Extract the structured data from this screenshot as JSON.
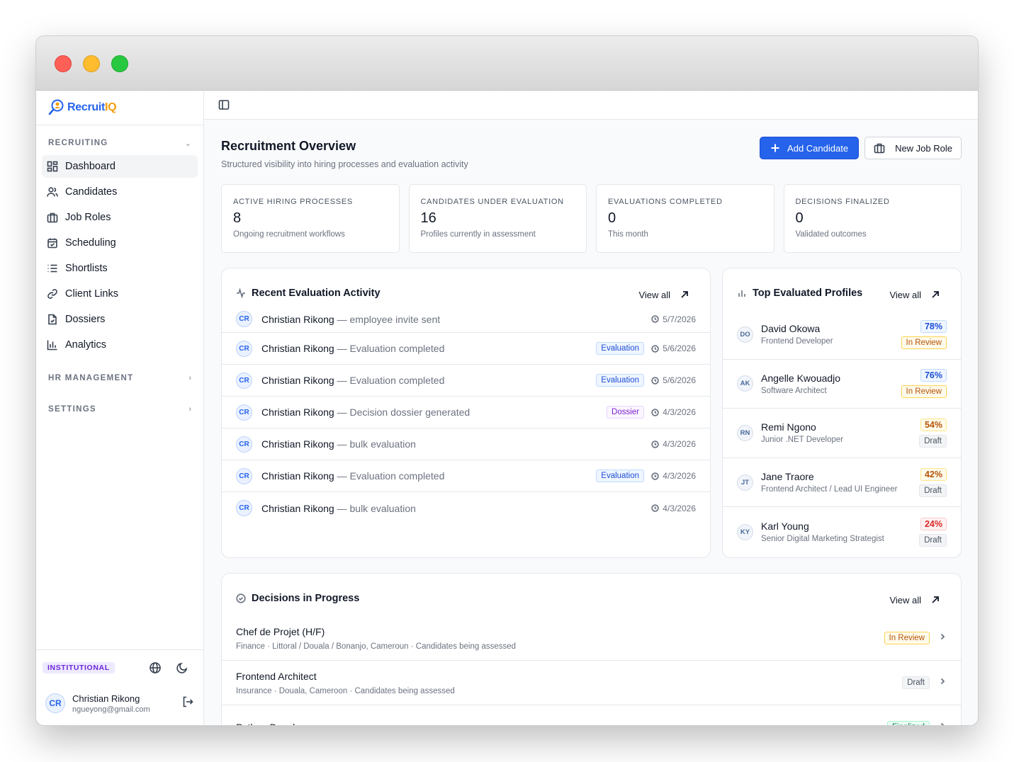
{
  "app": {
    "logo_main": "Recruit",
    "logo_accent": "IQ"
  },
  "sidebar": {
    "sections": [
      {
        "label": "RECRUITING"
      },
      {
        "label": "HR MANAGEMENT"
      },
      {
        "label": "SETTINGS"
      }
    ],
    "items": [
      {
        "label": "Dashboard",
        "icon": "dashboard-icon"
      },
      {
        "label": "Candidates",
        "icon": "users-icon"
      },
      {
        "label": "Job Roles",
        "icon": "briefcase-icon"
      },
      {
        "label": "Scheduling",
        "icon": "calendar-icon"
      },
      {
        "label": "Shortlists",
        "icon": "list-icon"
      },
      {
        "label": "Client Links",
        "icon": "link-icon"
      },
      {
        "label": "Dossiers",
        "icon": "file-icon"
      },
      {
        "label": "Analytics",
        "icon": "bar-chart-icon"
      }
    ],
    "footer": {
      "badge": "INSTITUTIONAL",
      "user_initials": "CR",
      "user_name": "Christian Rikong",
      "user_email": "ngueyong@gmail.com"
    }
  },
  "header": {
    "title": "Recruitment Overview",
    "subtitle": "Structured visibility into hiring processes and evaluation activity",
    "add_candidate": "Add Candidate",
    "new_job_role": "New Job Role"
  },
  "stats": [
    {
      "label": "ACTIVE HIRING PROCESSES",
      "value": "8",
      "note": "Ongoing recruitment workflows"
    },
    {
      "label": "CANDIDATES UNDER EVALUATION",
      "value": "16",
      "note": "Profiles currently in assessment"
    },
    {
      "label": "EVALUATIONS COMPLETED",
      "value": "0",
      "note": "This month"
    },
    {
      "label": "DECISIONS FINALIZED",
      "value": "0",
      "note": "Validated outcomes"
    }
  ],
  "activity": {
    "title": "Recent Evaluation Activity",
    "view_all": "View all",
    "rows": [
      {
        "initials": "CR",
        "name": "Christian Rikong",
        "desc": " — employee invite sent",
        "tag": "",
        "date": "5/7/2026"
      },
      {
        "initials": "CR",
        "name": "Christian Rikong",
        "desc": " — Evaluation completed",
        "tag": "Evaluation",
        "date": "5/6/2026"
      },
      {
        "initials": "CR",
        "name": "Christian Rikong",
        "desc": " — Evaluation completed",
        "tag": "Evaluation",
        "date": "5/6/2026"
      },
      {
        "initials": "CR",
        "name": "Christian Rikong",
        "desc": " — Decision dossier generated",
        "tag": "Dossier",
        "date": "4/3/2026"
      },
      {
        "initials": "CR",
        "name": "Christian Rikong",
        "desc": " — bulk evaluation",
        "tag": "",
        "date": "4/3/2026"
      },
      {
        "initials": "CR",
        "name": "Christian Rikong",
        "desc": " — Evaluation completed",
        "tag": "Evaluation",
        "date": "4/3/2026"
      },
      {
        "initials": "CR",
        "name": "Christian Rikong",
        "desc": " — bulk evaluation",
        "tag": "",
        "date": "4/3/2026"
      }
    ]
  },
  "top_profiles": {
    "title": "Top Evaluated Profiles",
    "view_all": "View all",
    "rows": [
      {
        "initials": "DO",
        "name": "David Okowa",
        "role": "Frontend Developer",
        "score": "78%",
        "status": "In Review"
      },
      {
        "initials": "AK",
        "name": "Angelle Kwouadjo",
        "role": "Software Architect",
        "score": "76%",
        "status": "In Review"
      },
      {
        "initials": "RN",
        "name": "Remi Ngono",
        "role": "Junior .NET Developer",
        "score": "54%",
        "status": "Draft"
      },
      {
        "initials": "JT",
        "name": "Jane Traore",
        "role": "Frontend Architect / Lead UI Engineer",
        "score": "42%",
        "status": "Draft"
      },
      {
        "initials": "KY",
        "name": "Karl Young",
        "role": "Senior Digital Marketing Strategist",
        "score": "24%",
        "status": "Draft"
      }
    ]
  },
  "decisions": {
    "title": "Decisions in Progress",
    "view_all": "View all",
    "rows": [
      {
        "title": "Chef de Projet (H/F)",
        "meta": "Finance · Littoral / Douala / Bonanjo, Cameroun · Candidates being assessed",
        "status": "In Review"
      },
      {
        "title": "Frontend Architect",
        "meta": "Insurance · Douala, Cameroon · Candidates being assessed",
        "status": "Draft"
      },
      {
        "title": "Python Developer",
        "meta": "",
        "status": "Finalized"
      }
    ]
  },
  "colors": {
    "accent": "#2563eb",
    "logo_accent": "#f59e0b",
    "badge_purple": "#6d28d9"
  }
}
